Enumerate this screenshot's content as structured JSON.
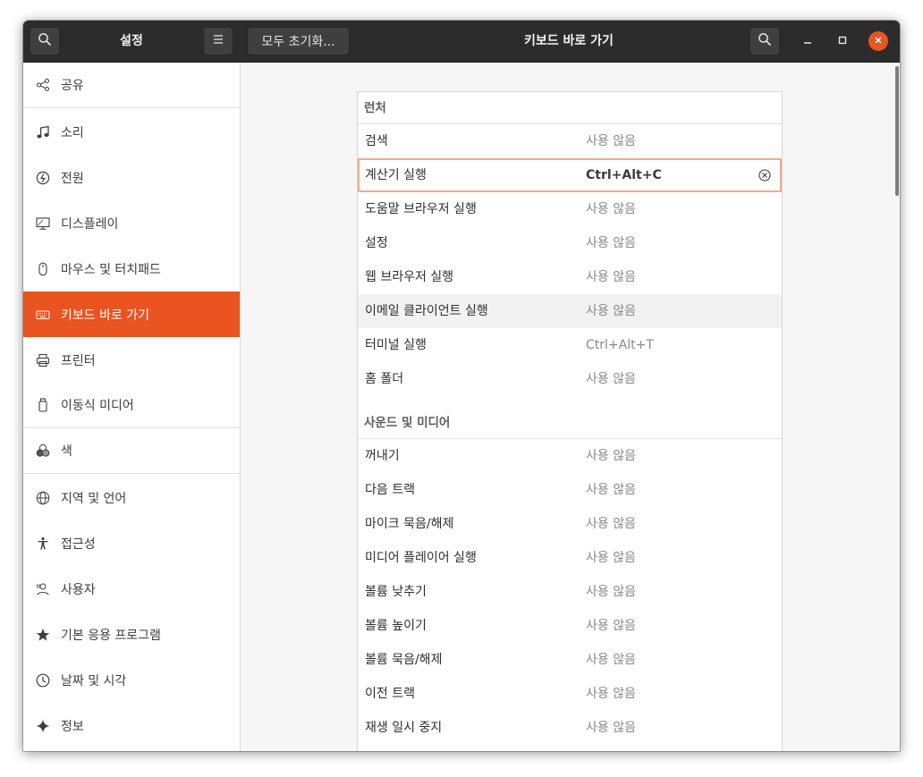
{
  "titlebar": {
    "sidebar_title": "설정",
    "reset_button_label": "모두 초기화...",
    "page_title": "키보드 바로 가기"
  },
  "sidebar": {
    "items": [
      {
        "label": "공유",
        "icon": "share-icon"
      },
      {
        "label": "소리",
        "icon": "music-note-icon"
      },
      {
        "label": "전원",
        "icon": "power-icon"
      },
      {
        "label": "디스플레이",
        "icon": "display-icon"
      },
      {
        "label": "마우스 및 터치패드",
        "icon": "mouse-icon"
      },
      {
        "label": "키보드 바로 가기",
        "icon": "keyboard-icon",
        "active": true
      },
      {
        "label": "프린터",
        "icon": "printer-icon"
      },
      {
        "label": "이동식 미디어",
        "icon": "removable-media-icon"
      },
      {
        "label": "색",
        "icon": "color-icon"
      },
      {
        "label": "지역 및 언어",
        "icon": "globe-icon"
      },
      {
        "label": "접근성",
        "icon": "accessibility-icon"
      },
      {
        "label": "사용자",
        "icon": "users-icon"
      },
      {
        "label": "기본 응용 프로그램",
        "icon": "star-icon"
      },
      {
        "label": "날짜 및 시각",
        "icon": "clock-icon"
      },
      {
        "label": "정보",
        "icon": "sparkle-icon"
      }
    ]
  },
  "sections": [
    {
      "title": "런처",
      "rows": [
        {
          "name": "검색",
          "accel": "사용 않음"
        },
        {
          "name": "계산기 실행",
          "accel": "Ctrl+Alt+C"
        },
        {
          "name": "도움말 브라우저 실행",
          "accel": "사용 않음"
        },
        {
          "name": "설정",
          "accel": "사용 않음"
        },
        {
          "name": "웹 브라우저 실행",
          "accel": "사용 않음"
        },
        {
          "name": "이메일 클라이언트 실행",
          "accel": "사용 않음"
        },
        {
          "name": "터미널 실행",
          "accel": "Ctrl+Alt+T"
        },
        {
          "name": "홈 폴더",
          "accel": "사용 않음"
        }
      ]
    },
    {
      "title": "사운드 및 미디어",
      "rows": [
        {
          "name": "꺼내기",
          "accel": "사용 않음"
        },
        {
          "name": "다음 트랙",
          "accel": "사용 않음"
        },
        {
          "name": "마이크 묵음/해제",
          "accel": "사용 않음"
        },
        {
          "name": "미디어 플레이어 실행",
          "accel": "사용 않음"
        },
        {
          "name": "볼륨 낮추기",
          "accel": "사용 않음"
        },
        {
          "name": "볼륨 높이기",
          "accel": "사용 않음"
        },
        {
          "name": "볼륨 묵음/해제",
          "accel": "사용 않음"
        },
        {
          "name": "이전 트랙",
          "accel": "사용 않음"
        },
        {
          "name": "재생 일시 중지",
          "accel": "사용 않음"
        }
      ]
    }
  ],
  "colors": {
    "accent": "#e95420",
    "titlebar": "#2c2c2c",
    "selected_border": "#f2a98b"
  }
}
